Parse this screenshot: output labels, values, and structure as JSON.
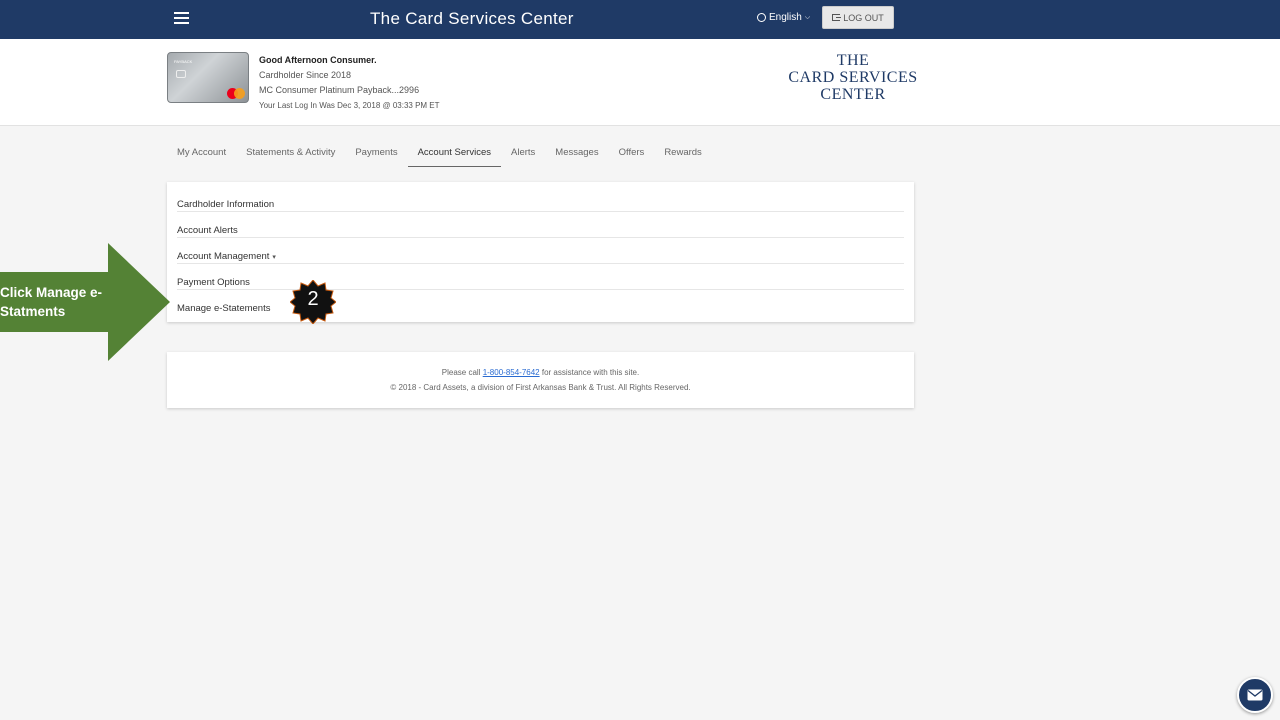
{
  "topbar": {
    "title": "The Card Services Center",
    "language": "English",
    "logout_label": "LOG OUT"
  },
  "account": {
    "greeting": "Good Afternoon Consumer.",
    "since": "Cardholder Since 2018",
    "product": "MC Consumer Platinum Payback...2996",
    "last_login": "Your Last Log In Was Dec 3, 2018 @ 03:33 PM ET",
    "card_brand": "PAYBACK"
  },
  "brand_logo": {
    "line1": "THE",
    "line2": "CARD SERVICES",
    "line3": "CENTER"
  },
  "tabs": [
    {
      "label": "My Account"
    },
    {
      "label": "Statements & Activity"
    },
    {
      "label": "Payments"
    },
    {
      "label": "Account Services",
      "active": true
    },
    {
      "label": "Alerts"
    },
    {
      "label": "Messages"
    },
    {
      "label": "Offers"
    },
    {
      "label": "Rewards"
    }
  ],
  "menu": [
    {
      "label": "Cardholder Information"
    },
    {
      "label": "Account Alerts"
    },
    {
      "label": "Account Management",
      "caret": "▾"
    },
    {
      "label": "Payment Options"
    },
    {
      "label": "Manage e-Statements"
    }
  ],
  "footer": {
    "prefix": "Please call ",
    "phone": "1-800-854-7642",
    "suffix": " for assistance with this site.",
    "copyright": "© 2018 - Card Assets, a division of First Arkansas Bank & Trust. All Rights Reserved."
  },
  "callout": {
    "text": "Click Manage e-Statments",
    "step": "2",
    "arrow_color": "#548235",
    "badge_color": "#111111"
  },
  "colors": {
    "navy": "#1f3a66",
    "link": "#2a6bd1"
  },
  "icons": {
    "menu": "hamburger-icon",
    "language": "globe-icon",
    "logout": "sign-out-icon",
    "chat": "envelope-icon"
  }
}
